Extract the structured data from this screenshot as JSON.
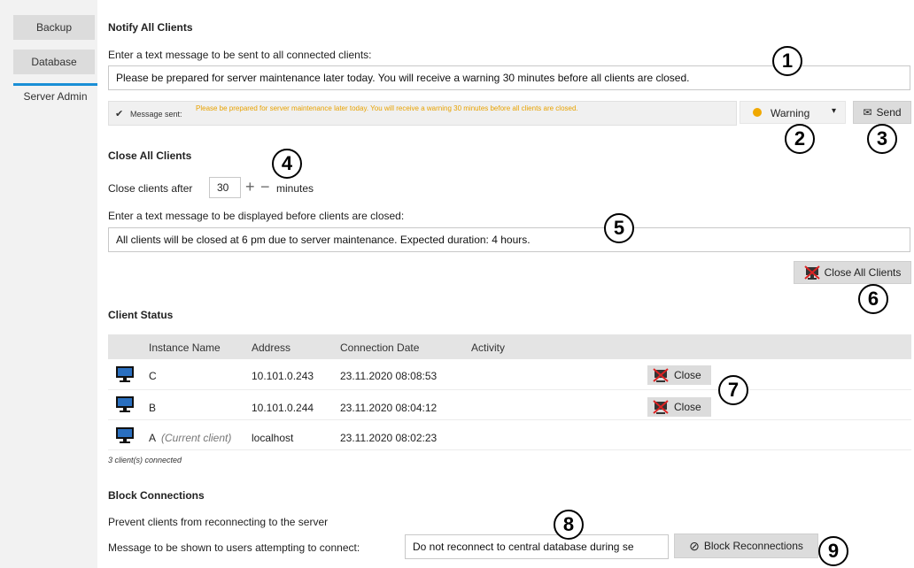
{
  "sidebar": {
    "items": [
      {
        "label": "Backup"
      },
      {
        "label": "Database"
      },
      {
        "label": "Server Admin"
      }
    ]
  },
  "notify": {
    "title": "Notify All Clients",
    "prompt": "Enter a text message to be sent to all connected clients:",
    "message_value": "Please be prepared for server maintenance later today. You will receive a warning 30 minutes before all clients are closed.",
    "sent_label": "Message sent:",
    "sent_message": "Please be prepared for server maintenance later today. You will receive a warning 30 minutes before all clients are closed.",
    "severity": "Warning",
    "severity_color": "#f0a800",
    "send_label": "Send"
  },
  "close": {
    "title": "Close All Clients",
    "after_label": "Close clients after",
    "minutes_value": "30",
    "minutes_label": "minutes",
    "prompt": "Enter a text message to be displayed before clients are closed:",
    "message_value": "All clients will be closed at 6 pm due to server maintenance. Expected duration: 4 hours.",
    "close_all_label": "Close All Clients"
  },
  "status": {
    "title": "Client Status",
    "columns": [
      "Instance Name",
      "Address",
      "Connection Date",
      "Activity"
    ],
    "rows": [
      {
        "name": "C",
        "note": "",
        "address": "10.101.0.243",
        "date": "23.11.2020 08:08:53",
        "action": "Close"
      },
      {
        "name": "B",
        "note": "",
        "address": "10.101.0.244",
        "date": "23.11.2020 08:04:12",
        "action": "Close"
      },
      {
        "name": "A",
        "note": "(Current client)",
        "address": "localhost",
        "date": "23.11.2020 08:02:23",
        "action": ""
      }
    ],
    "count_text": "3 client(s) connected"
  },
  "block": {
    "title": "Block Connections",
    "description": "Prevent clients from reconnecting to the server",
    "message_label": "Message to be shown to users attempting to connect:",
    "message_value": "Do not reconnect to central database during se",
    "button_label": "Block Reconnections"
  },
  "callouts": [
    "1",
    "2",
    "3",
    "4",
    "5",
    "6",
    "7",
    "8",
    "9"
  ],
  "icons": {
    "check": "✔",
    "envelope": "✉",
    "block": "⊘",
    "dropdown": "▾",
    "plus": "+",
    "minus": "−"
  }
}
